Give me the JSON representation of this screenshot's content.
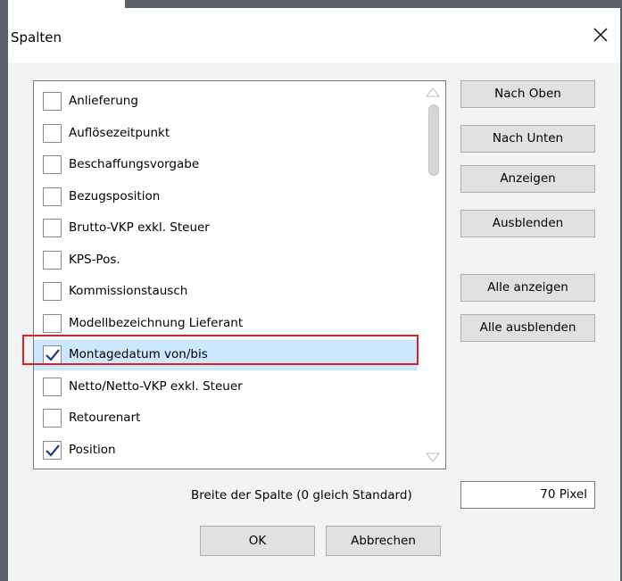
{
  "dialog": {
    "title": "Spalten",
    "close_icon": "close-icon"
  },
  "columns": [
    {
      "label": "Anlieferung",
      "checked": false
    },
    {
      "label": "Auflösezeitpunkt",
      "checked": false
    },
    {
      "label": "Beschaffungsvorgabe",
      "checked": false
    },
    {
      "label": "Bezugsposition",
      "checked": false
    },
    {
      "label": "Brutto-VKP exkl. Steuer",
      "checked": false
    },
    {
      "label": "KPS-Pos.",
      "checked": false
    },
    {
      "label": "Kommissionstausch",
      "checked": false
    },
    {
      "label": "Modellbezeichnung Lieferant",
      "checked": false
    },
    {
      "label": "Montagedatum von/bis",
      "checked": true,
      "selected": true
    },
    {
      "label": "Netto/Netto-VKP exkl. Steuer",
      "checked": false
    },
    {
      "label": "Retourenart",
      "checked": false
    },
    {
      "label": "Position",
      "checked": true
    }
  ],
  "side_buttons": {
    "move_up": "Nach Oben",
    "move_down": "Nach Unten",
    "show": "Anzeigen",
    "hide": "Ausblenden",
    "show_all": "Alle anzeigen",
    "hide_all": "Alle ausblenden"
  },
  "column_width": {
    "label": "Breite der Spalte (0 gleich Standard)",
    "value": "70 Pixel"
  },
  "footer": {
    "ok": "OK",
    "cancel": "Abbrechen"
  },
  "colors": {
    "selection": "#cce8ff",
    "highlight_border": "#e02020",
    "check": "#1a3c8c"
  }
}
